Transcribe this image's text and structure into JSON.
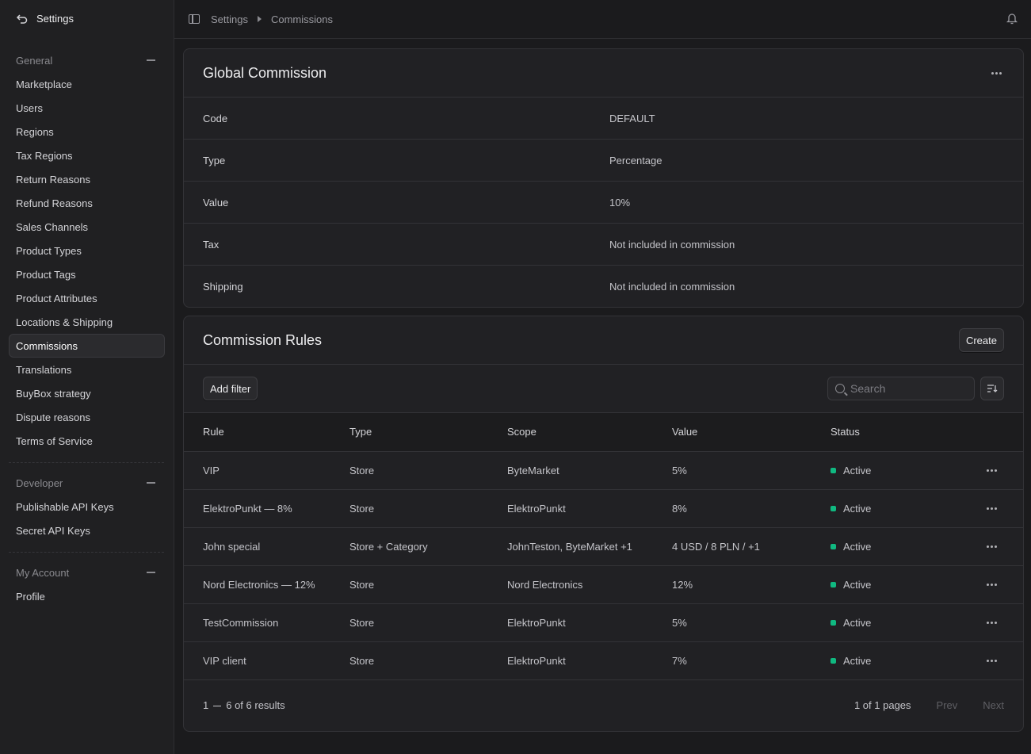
{
  "sidebar": {
    "title": "Settings",
    "general": {
      "heading": "General",
      "items": [
        "Marketplace",
        "Users",
        "Regions",
        "Tax Regions",
        "Return Reasons",
        "Refund Reasons",
        "Sales Channels",
        "Product Types",
        "Product Tags",
        "Product Attributes",
        "Locations & Shipping",
        "Commissions",
        "Translations",
        "BuyBox strategy",
        "Dispute reasons",
        "Terms of Service"
      ],
      "active": "Commissions"
    },
    "developer": {
      "heading": "Developer",
      "items": [
        "Publishable API Keys",
        "Secret API Keys"
      ]
    },
    "account": {
      "heading": "My Account",
      "items": [
        "Profile"
      ]
    }
  },
  "breadcrumb": [
    "Settings",
    "Commissions"
  ],
  "global": {
    "title": "Global Commission",
    "rows": [
      {
        "key": "Code",
        "value": "DEFAULT"
      },
      {
        "key": "Type",
        "value": "Percentage"
      },
      {
        "key": "Value",
        "value": "10%"
      },
      {
        "key": "Tax",
        "value": "Not included in commission"
      },
      {
        "key": "Shipping",
        "value": "Not included in commission"
      }
    ]
  },
  "rules": {
    "title": "Commission Rules",
    "create_label": "Create",
    "add_filter_label": "Add filter",
    "search_placeholder": "Search",
    "columns": [
      "Rule",
      "Type",
      "Scope",
      "Value",
      "Status"
    ],
    "rows": [
      {
        "rule": "VIP",
        "type": "Store",
        "scope": "ByteMarket",
        "value": "5%",
        "status": "Active"
      },
      {
        "rule": "ElektroPunkt — 8%",
        "type": "Store",
        "scope": "ElektroPunkt",
        "value": "8%",
        "status": "Active"
      },
      {
        "rule": "John special",
        "type": "Store + Category",
        "scope": "JohnTeston, ByteMarket +1",
        "value": "4 USD / 8 PLN / +1",
        "status": "Active"
      },
      {
        "rule": "Nord Electronics — 12%",
        "type": "Store",
        "scope": "Nord Electronics",
        "value": "12%",
        "status": "Active"
      },
      {
        "rule": "TestCommission",
        "type": "Store",
        "scope": "ElektroPunkt",
        "value": "5%",
        "status": "Active"
      },
      {
        "rule": "VIP client",
        "type": "Store",
        "scope": "ElektroPunkt",
        "value": "7%",
        "status": "Active"
      }
    ],
    "pager": {
      "range_start": "1",
      "range_end": "6 of 6 results",
      "pages": "1 of 1 pages",
      "prev": "Prev",
      "next": "Next"
    },
    "status_color": "#10b981"
  }
}
